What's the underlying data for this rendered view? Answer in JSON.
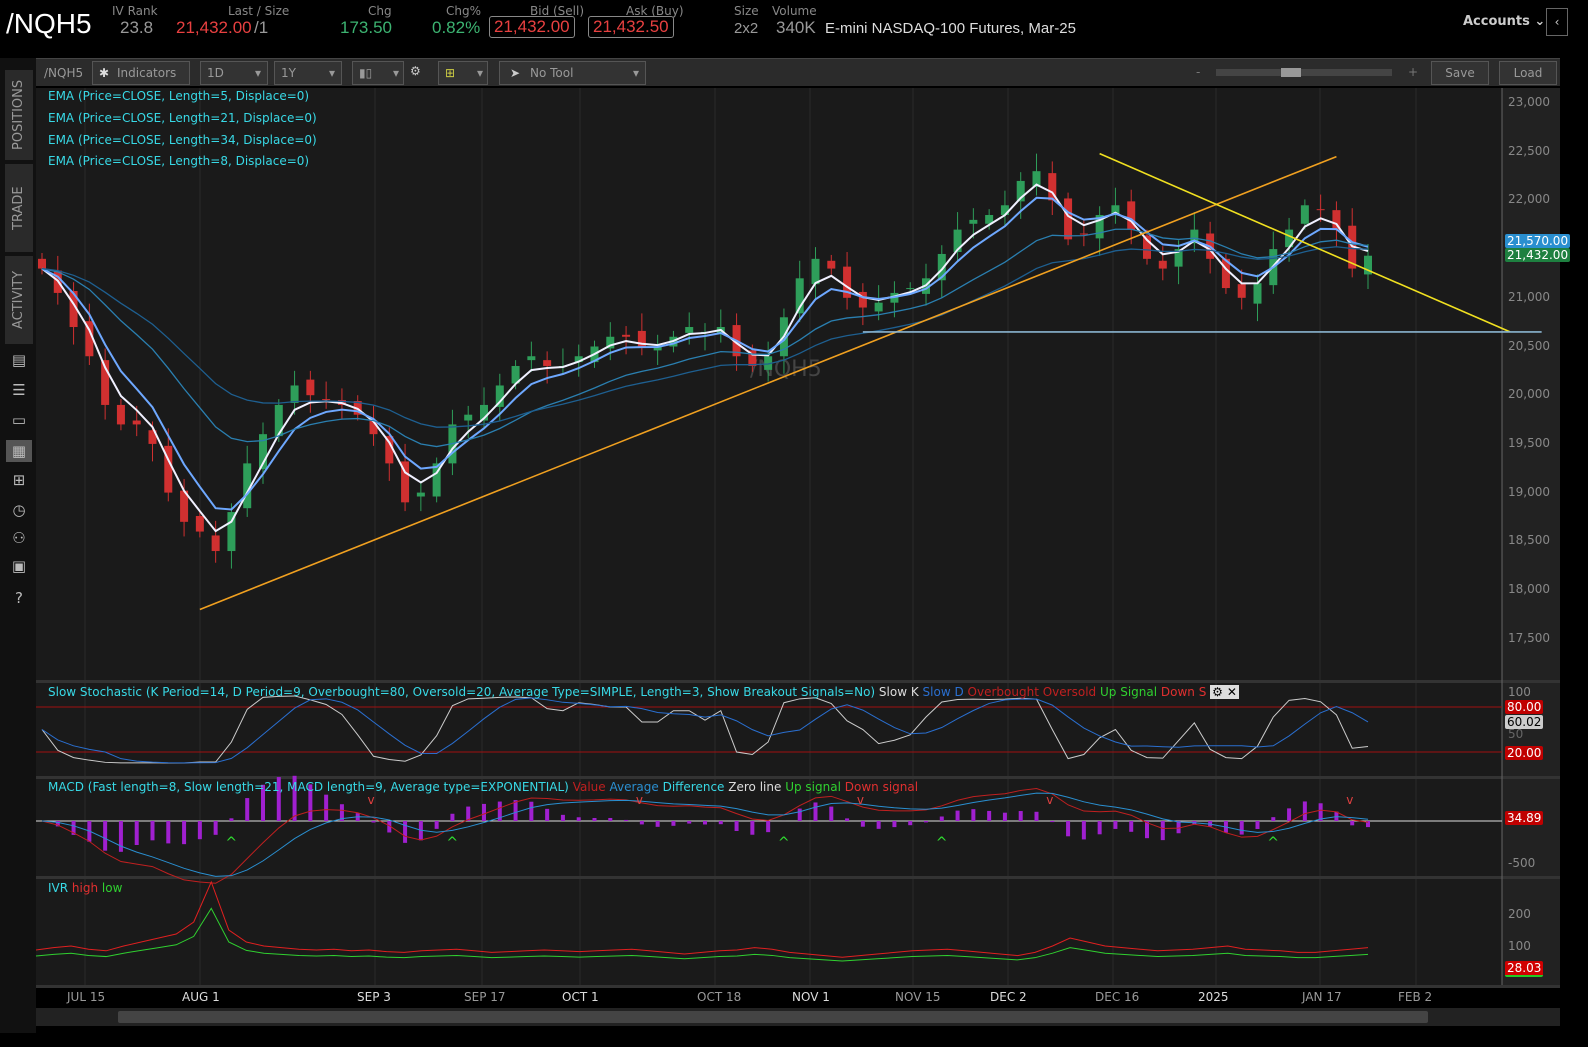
{
  "header": {
    "symbol": "/NQH5",
    "iv_rank_label": "IV Rank",
    "iv_rank": "23.8",
    "last_label": "Last / Size",
    "last": "21,432.00",
    "size": "/1",
    "chg_label": "Chg",
    "chg": "173.50",
    "chgp_label": "Chg%",
    "chgp": "0.82%",
    "bid_label": "Bid (Sell)",
    "bid": "21,432.00",
    "ask_label": "Ask (Buy)",
    "ask": "21,432.50",
    "size_label": "Size",
    "size_val": "2x2",
    "volume_label": "Volume",
    "volume": "340K",
    "description": "E-mini NASDAQ-100 Futures, Mar-25",
    "accounts": "Accounts"
  },
  "toolbar": {
    "symbol": "/NQH5",
    "indicators": "Indicators",
    "aggregation": "1D",
    "period": "1Y",
    "tool": "No Tool",
    "zoom_minus": "-",
    "zoom_plus": "+",
    "save": "Save",
    "load": "Load",
    "zoom_level": 0.2
  },
  "sidebar": {
    "tabs": [
      "POSITIONS",
      "TRADE",
      "ACTIVITY"
    ]
  },
  "studies": [
    "EMA (Price=CLOSE, Length=5, Displace=0)",
    "EMA (Price=CLOSE, Length=21, Displace=0)",
    "EMA (Price=CLOSE, Length=34, Displace=0)",
    "EMA (Price=CLOSE, Length=8, Displace=0)"
  ],
  "watermark": "/NQH5",
  "stoch": {
    "title": "Slow Stochastic (K Period=14, D Period=9, Overbought=80, Oversold=20, Average Type=SIMPLE, Length=3, Show Breakout Signals=No)",
    "k": "Slow K",
    "d": "Slow D",
    "ob": "Overbought",
    "os": "Oversold",
    "up": "Up Signal",
    "down": "Down S",
    "axis": [
      "100",
      "50"
    ],
    "tags": [
      "80.00",
      "60.02",
      "20.00"
    ]
  },
  "macd": {
    "title": "MACD (Fast length=8, Slow length=21, MACD length=9, Average type=EXPONENTIAL)",
    "value": "Value",
    "avg": "Average",
    "diff": "Difference",
    "zero": "Zero line",
    "up": "Up signal",
    "down": "Down signal",
    "axis": [
      "-500"
    ],
    "tag": "34.89"
  },
  "ivr": {
    "title": "IVR",
    "high": "high",
    "low": "low",
    "axis": [
      "200",
      "100"
    ],
    "tag": "28.03",
    "values": [
      25,
      28,
      30,
      26,
      24,
      30,
      35,
      40,
      45,
      60,
      110,
      50,
      35,
      30,
      28,
      26,
      25,
      26,
      24,
      25,
      23,
      22,
      24,
      25,
      26,
      24,
      22,
      23,
      24,
      25,
      24,
      23,
      24,
      25,
      26,
      24,
      22,
      20,
      22,
      24,
      25,
      28,
      26,
      22,
      20,
      18,
      16,
      18,
      20,
      22,
      24,
      25,
      26,
      24,
      22,
      20,
      18,
      22,
      30,
      40,
      35,
      30,
      28,
      26,
      24,
      25,
      26,
      28,
      30,
      26,
      25,
      24,
      22,
      22,
      24,
      26,
      28
    ]
  },
  "chart_data": {
    "type": "candlestick",
    "price_axis": [
      "23,000",
      "22,500",
      "22,000",
      "21,500",
      "21,000",
      "20,500",
      "20,000",
      "19,500",
      "19,000",
      "18,500",
      "18,000",
      "17,500"
    ],
    "ylim": [
      17000,
      23200
    ],
    "x_labels": [
      "JUL 15",
      "AUG 1",
      "SEP 3",
      "SEP 17",
      "OCT 1",
      "OCT 18",
      "NOV 1",
      "NOV 15",
      "DEC 2",
      "DEC 16",
      "2025",
      "JAN 17",
      "FEB 2"
    ],
    "closes": [
      21300,
      21050,
      20700,
      20400,
      19900,
      19700,
      19700,
      19500,
      19000,
      18700,
      18600,
      18400,
      18800,
      19300,
      19600,
      19900,
      20100,
      20000,
      19950,
      19900,
      19800,
      19600,
      19300,
      18900,
      19000,
      19300,
      19700,
      19800,
      19900,
      20100,
      20300,
      20400,
      20300,
      20300,
      20400,
      20500,
      20600,
      20600,
      20500,
      20500,
      20600,
      20700,
      20650,
      20700,
      20400,
      20300,
      20400,
      20800,
      21200,
      21400,
      21300,
      21000,
      20900,
      20950,
      21050,
      21100,
      21200,
      21450,
      21700,
      21800,
      21850,
      21950,
      22200,
      22300,
      22000,
      21600,
      21650,
      21850,
      21950,
      21700,
      21400,
      21300,
      21500,
      21700,
      21400,
      21100,
      21000,
      21150,
      21500,
      21700,
      21950,
      21900,
      21700,
      21300,
      21432
    ],
    "last_tag": "21,432.00",
    "ema_tag": "21,570.00",
    "trendlines": [
      {
        "name": "orange-trendline",
        "from": [
          10,
          17800
        ],
        "to": [
          82,
          22450
        ],
        "color": "#f0a020"
      },
      {
        "name": "yellow-trendline",
        "from": [
          67,
          22480
        ],
        "to": [
          93,
          20650
        ],
        "color": "#f0e020"
      },
      {
        "name": "support-line",
        "from": [
          52,
          20650
        ],
        "to": [
          95,
          20650
        ],
        "color": "#8ab4d0"
      }
    ]
  },
  "colors": {
    "up": "#2e9e5a",
    "down": "#d03030",
    "ema": "#38d9e6"
  }
}
